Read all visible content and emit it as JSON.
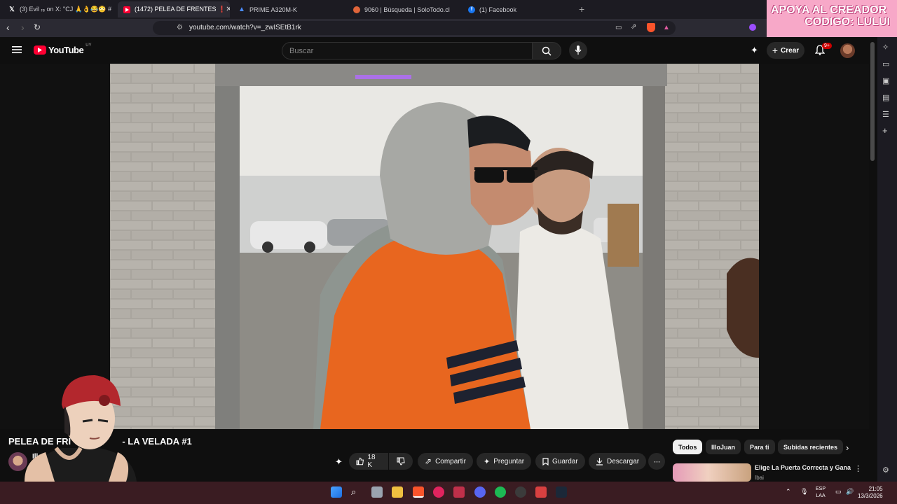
{
  "browser": {
    "tabs": [
      {
        "label": "(3) Evil ᵣₑ on X: \"CJ 🙏👌😂😳 #",
        "icon": "x-logo-icon",
        "color": "#ffffff"
      },
      {
        "label": "(1472) PELEA DE FRENTES ❗",
        "icon": "youtube-icon",
        "color": "#ff0033"
      },
      {
        "label": "PRIME A320M-K",
        "icon": "asus-icon",
        "color": "#4a8cff"
      },
      {
        "label": "9060 | Búsqueda | SoloTodo.cl",
        "icon": "solotodo-icon",
        "color": "#e0653a"
      },
      {
        "label": "(1) Facebook",
        "icon": "facebook-icon",
        "color": "#1877f2"
      }
    ],
    "url": "youtube.com/watch?v=_zwISEtB1rk"
  },
  "banner": {
    "line1": "APOYA AL CREADOR",
    "line2": "CODIGO: LULUI"
  },
  "youtube": {
    "logo_text": "YouTube",
    "region": "UY",
    "search_placeholder": "Buscar",
    "create_label": "Crear",
    "notif_badge": "9+"
  },
  "video": {
    "title": "PELEA DE FRENTES - LA VELADA #1",
    "title_visible_left": "PELEA DE FRI",
    "title_visible_right": "- LA VELADA #1",
    "channel": "IlloJu"
  },
  "actions": {
    "likes": "18 K",
    "share": "Compartir",
    "ask": "Preguntar",
    "save": "Guardar",
    "download": "Descargar"
  },
  "chips": [
    "Todos",
    "IlloJuan",
    "Para ti",
    "Subidas recientes"
  ],
  "suggestion": {
    "title": "Elige La Puerta Correcta y Gana",
    "channel": "Ibai"
  },
  "taskbar": {
    "lang1": "ESP",
    "lang2": "LAA",
    "time": "21:05",
    "date": "13/3/2026"
  },
  "colors": {
    "accent": "#ff0033",
    "orange_vest": "#e8661f",
    "bg": "#0f0f0f"
  }
}
